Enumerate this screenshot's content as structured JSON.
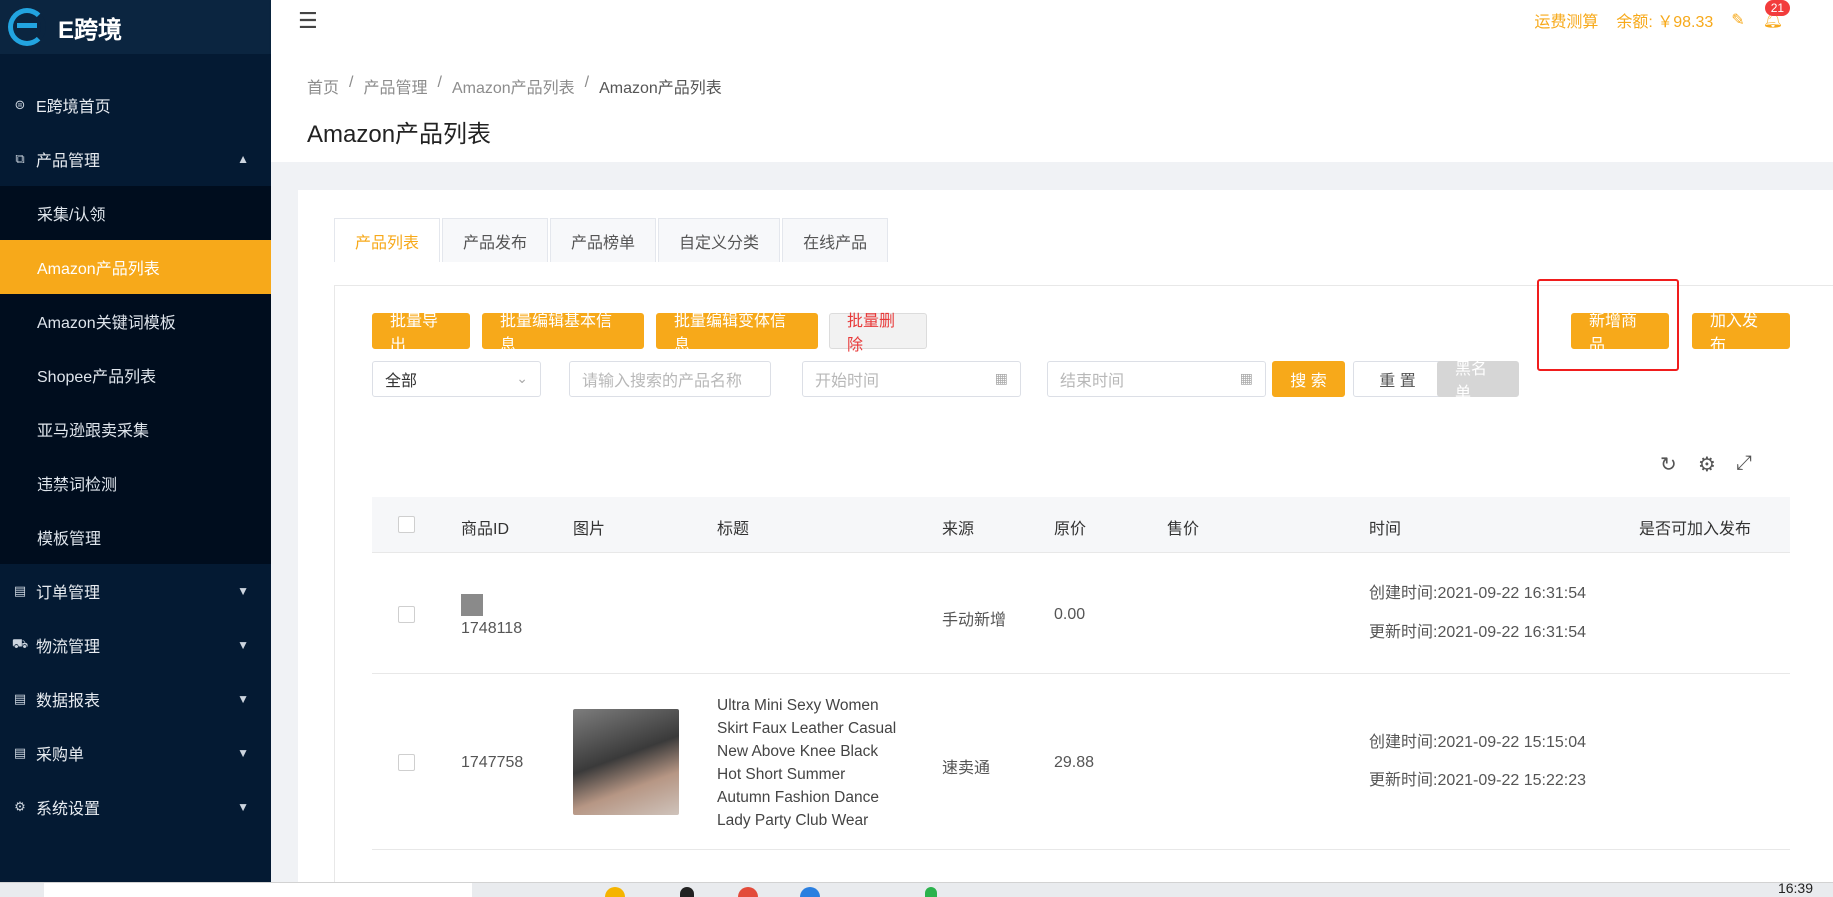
{
  "app": {
    "logo_text": "E跨境"
  },
  "sidebar": {
    "items": [
      {
        "label": "E跨境首页",
        "icon": "home-icon"
      },
      {
        "label": "产品管理",
        "icon": "product-icon",
        "expanded": true,
        "children": [
          "采集/认领",
          "Amazon产品列表",
          "Amazon关键词模板",
          "Shopee产品列表",
          "亚马逊跟卖采集",
          "违禁词检测",
          "模板管理"
        ],
        "active_child": "Amazon产品列表"
      },
      {
        "label": "订单管理",
        "icon": "order-icon"
      },
      {
        "label": "物流管理",
        "icon": "truck-icon"
      },
      {
        "label": "数据报表",
        "icon": "report-icon"
      },
      {
        "label": "采购单",
        "icon": "purchase-icon"
      },
      {
        "label": "系统设置",
        "icon": "gear-icon"
      }
    ]
  },
  "header": {
    "freight_calc": "运费测算",
    "balance": "余额: ￥98.33",
    "notification_count": "21"
  },
  "breadcrumb": [
    "首页",
    "产品管理",
    "Amazon产品列表",
    "Amazon产品列表"
  ],
  "page_title": "Amazon产品列表",
  "tabs": [
    "产品列表",
    "产品发布",
    "产品榜单",
    "自定义分类",
    "在线产品"
  ],
  "active_tab": "产品列表",
  "toolbar": {
    "batch_export": "批量导出",
    "batch_edit_basic": "批量编辑基本信息",
    "batch_edit_variant": "批量编辑变体信息",
    "batch_delete": "批量删除",
    "add_product": "新增商品",
    "add_publish": "加入发布"
  },
  "filters": {
    "category_value": "全部",
    "name_placeholder": "请输入搜索的产品名称",
    "start_placeholder": "开始时间",
    "end_placeholder": "结束时间",
    "search": "搜 索",
    "reset": "重 置",
    "blacklist": "黑名单"
  },
  "table": {
    "columns": [
      "商品ID",
      "图片",
      "标题",
      "来源",
      "原价",
      "售价",
      "时间",
      "是否可加入发布"
    ],
    "rows": [
      {
        "id": "1748118",
        "title": "",
        "source": "手动新增",
        "price": "0.00",
        "sale_price": "",
        "created": "创建时间:2021-09-22 16:31:54",
        "updated": "更新时间:2021-09-22 16:31:54"
      },
      {
        "id": "1747758",
        "title_lines": [
          "Ultra Mini Sexy Women",
          "Skirt Faux Leather Casual",
          "New Above Knee Black",
          "Hot Short Summer",
          "Autumn Fashion Dance",
          "Lady Party Club Wear"
        ],
        "source": "速卖通",
        "price": "29.88",
        "sale_price": "",
        "created": "创建时间:2021-09-22 15:15:04",
        "updated": "更新时间:2021-09-22 15:22:23"
      }
    ]
  },
  "taskbar": {
    "clock": "16:39"
  },
  "colors": {
    "accent": "#f7a91a",
    "sidebar_bg": "#041a33",
    "highlight": "#f01d1d"
  }
}
